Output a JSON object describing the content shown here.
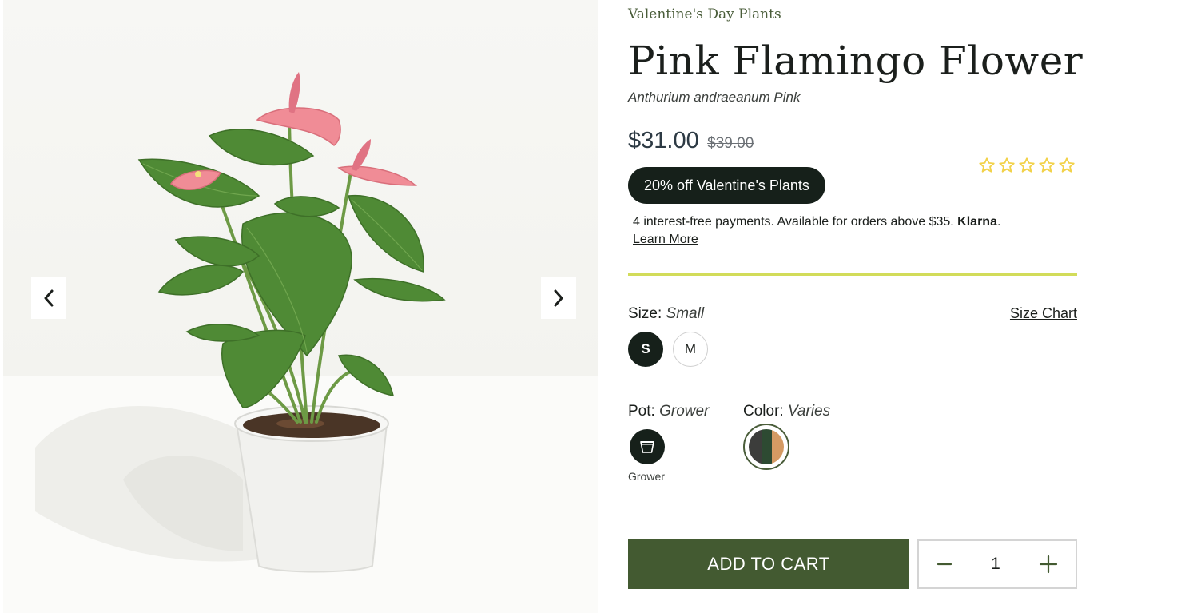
{
  "gallery": {
    "prev_label": "previous image",
    "next_label": "next image"
  },
  "product": {
    "collection": "Valentine's Day Plants",
    "name": "Pink Flamingo Flower",
    "latin_name": "Anthurium andraeanum Pink",
    "price": "$31.00",
    "original_price": "$39.00",
    "rating_stars": 0,
    "rating_max": 5,
    "promo_badge": "20% off Valentine's Plants"
  },
  "klarna": {
    "text": "4 interest-free payments. Available for orders above $35.",
    "brand": "Klarna",
    "period": ".",
    "learn_more": "Learn More"
  },
  "options": {
    "size": {
      "label": "Size:",
      "value": "Small",
      "chart_link": "Size Chart",
      "choices": [
        "S",
        "M"
      ],
      "selected": "S"
    },
    "pot": {
      "label": "Pot:",
      "value": "Grower",
      "caption": "Grower"
    },
    "color": {
      "label": "Color:",
      "value": "Varies"
    }
  },
  "cart": {
    "add_label": "ADD TO CART",
    "quantity": "1"
  },
  "colors": {
    "accent_dark": "#16201a",
    "cart_green": "#435a31",
    "divider_yellow": "#d2dc5a",
    "star_yellow": "#f2d24a",
    "collection_green": "#4a5d3a"
  }
}
